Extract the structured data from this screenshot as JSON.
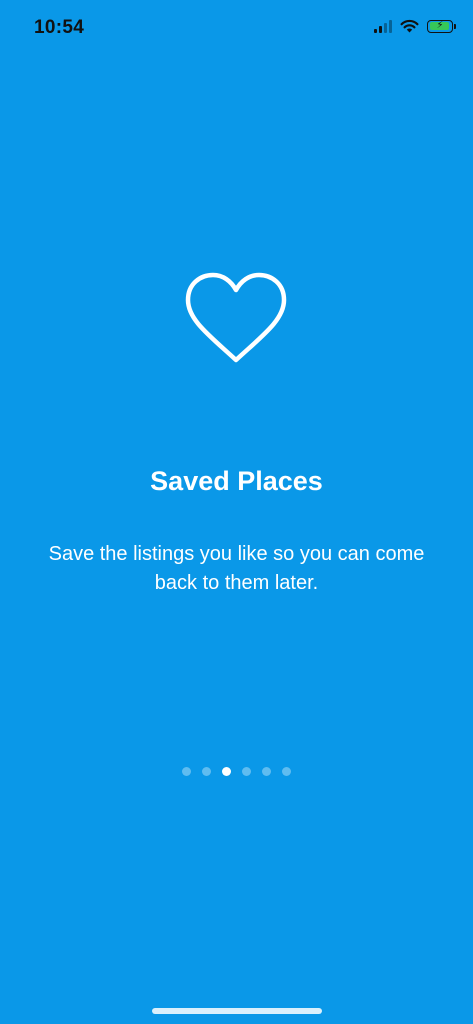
{
  "status_bar": {
    "time": "10:54",
    "signal_bars": 4,
    "signal_active_bars": 2,
    "wifi": "wifi-icon",
    "battery": "battery-charging-icon",
    "battery_color": "#36c759"
  },
  "onboarding": {
    "icon": "heart-outline-icon",
    "title": "Saved Places",
    "description": "Save the listings you like so you can come back to them later.",
    "page_count": 6,
    "current_page": 3
  },
  "colors": {
    "background": "#0a98e8",
    "text": "#ffffff"
  }
}
